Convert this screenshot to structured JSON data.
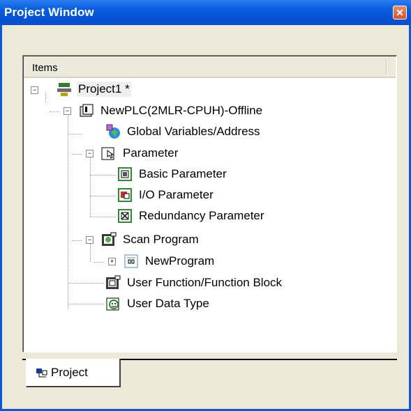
{
  "window": {
    "title": "Project Window",
    "close_glyph": "✕"
  },
  "tree_header": {
    "label": "Items"
  },
  "tree": [
    {
      "label": "Project1 *",
      "icon": "project-icon",
      "expanded": true
    },
    {
      "label": "NewPLC(2MLR-CPUH)-Offline",
      "icon": "plc-icon",
      "expanded": true
    },
    {
      "label": "Global Variables/Address",
      "icon": "global-variables-icon"
    },
    {
      "label": "Parameter",
      "icon": "parameter-icon",
      "expanded": true
    },
    {
      "label": "Basic Parameter",
      "icon": "basic-parameter-icon"
    },
    {
      "label": "I/O Parameter",
      "icon": "io-parameter-icon"
    },
    {
      "label": "Redundancy Parameter",
      "icon": "redundancy-parameter-icon"
    },
    {
      "label": "Scan Program",
      "icon": "scan-program-icon",
      "expanded": true
    },
    {
      "label": "NewProgram",
      "icon": "program-icon",
      "expanded": false
    },
    {
      "label": "User Function/Function Block",
      "icon": "function-block-icon"
    },
    {
      "label": "User Data Type",
      "icon": "data-type-icon"
    }
  ],
  "tabs": [
    {
      "label": "Project",
      "icon": "project-tab-icon",
      "active": true
    }
  ],
  "colors": {
    "titlebar": "#0a5fe0",
    "frame": "#ece9d8",
    "close": "#d2542c"
  }
}
